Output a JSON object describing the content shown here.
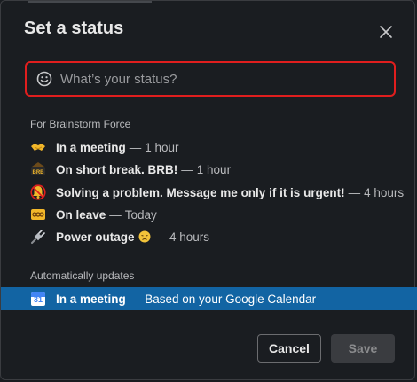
{
  "dialog": {
    "title": "Set a status"
  },
  "input": {
    "placeholder": "What’s your status?"
  },
  "workspace_section": {
    "label": "For Brainstorm Force",
    "items": [
      {
        "icon": "handshake-icon",
        "label": "In a meeting",
        "sep": "—",
        "duration": "1 hour"
      },
      {
        "icon": "brb-icon",
        "label": "On short break. BRB!",
        "sep": "—",
        "duration": "1 hour"
      },
      {
        "icon": "bell-mute-icon",
        "label": "Solving a problem. Message me only if it is urgent!",
        "sep": "—",
        "duration": "4 hours"
      },
      {
        "icon": "ooo-icon",
        "label": "On leave",
        "sep": "—",
        "duration": "Today"
      },
      {
        "icon": "plug-icon",
        "label": "Power outage",
        "sep": "—",
        "duration": "4 hours",
        "extra_icon": "disappointed-face-icon"
      }
    ]
  },
  "auto_section": {
    "label": "Automatically updates",
    "item": {
      "icon": "calendar-icon",
      "calendar_day": "31",
      "label": "In a meeting",
      "sep": "—",
      "detail": "Based on your Google Calendar"
    }
  },
  "buttons": {
    "cancel": "Cancel",
    "save": "Save"
  },
  "colors": {
    "background": "#1a1d21",
    "focus_border": "#e01e1e",
    "selected_row": "#1264a3"
  }
}
